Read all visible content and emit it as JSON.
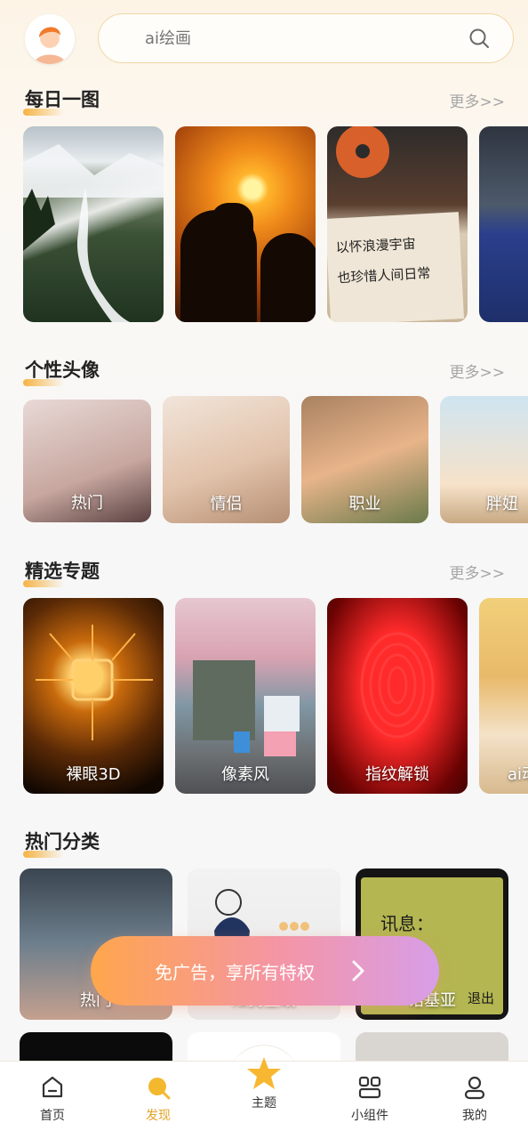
{
  "search": {
    "placeholder": "ai绘画"
  },
  "sections": {
    "daily": {
      "title": "每日一图",
      "more": "更多>>"
    },
    "avatars": {
      "title": "个性头像",
      "more": "更多>>",
      "items": [
        {
          "label": "热门"
        },
        {
          "label": "情侣"
        },
        {
          "label": "职业"
        },
        {
          "label": "胖妞"
        }
      ]
    },
    "topics": {
      "title": "精选专题",
      "more": "更多>>",
      "items": [
        {
          "label": "裸眼3D"
        },
        {
          "label": "像素风"
        },
        {
          "label": "指纹解锁"
        },
        {
          "label": "ai动"
        }
      ]
    },
    "hot": {
      "title": "热门分类",
      "items": [
        {
          "label": "热门"
        },
        {
          "label": "炫民壁纸"
        },
        {
          "label": "诺基亚"
        }
      ],
      "nokia_screen": {
        "text": "讯息：",
        "exit": "退出"
      }
    }
  },
  "daily_note": {
    "line1": "以怀浪漫宇宙",
    "line2": "也珍惜人间日常"
  },
  "promo": {
    "text": "免广告，享所有特权"
  },
  "nav": {
    "items": [
      {
        "label": "首页"
      },
      {
        "label": "发现"
      },
      {
        "label": "主题"
      },
      {
        "label": "小组件"
      },
      {
        "label": "我的"
      }
    ],
    "active": "发现"
  },
  "colors": {
    "accent": "#e2a227",
    "search_border": "#f0d7a7",
    "promo_start": "#ffa64c",
    "promo_end": "#d79ee8"
  }
}
